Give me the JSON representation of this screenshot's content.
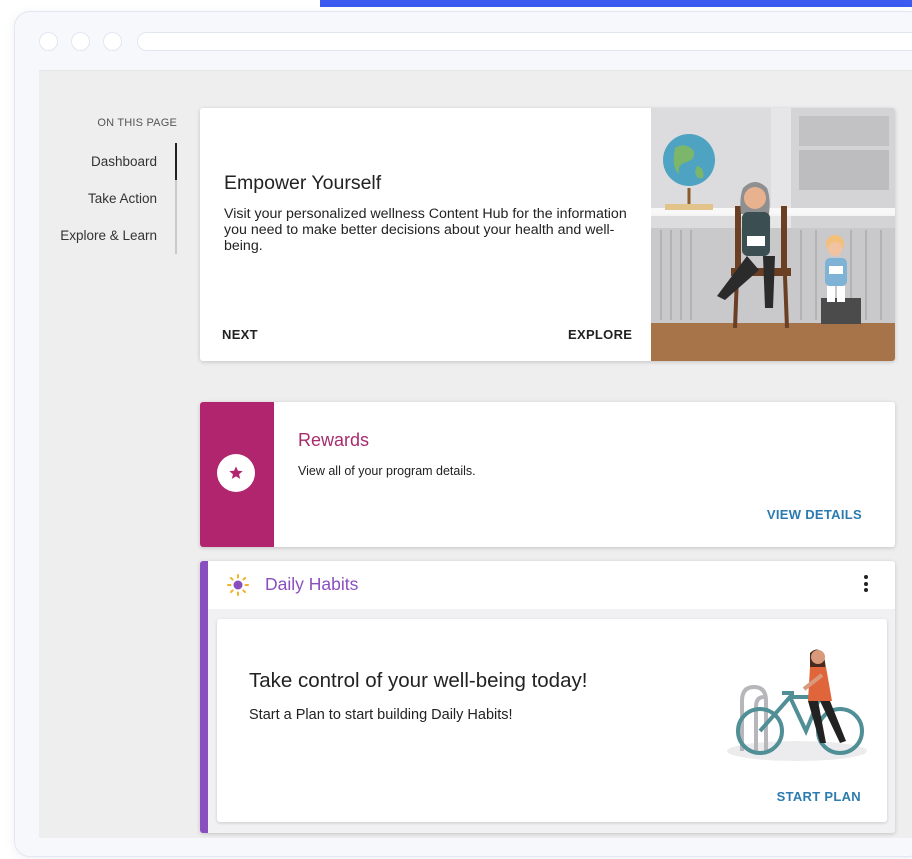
{
  "on_this_page": {
    "label": "ON THIS PAGE",
    "items": [
      {
        "label": "Dashboard",
        "active": true
      },
      {
        "label": "Take Action",
        "active": false
      },
      {
        "label": "Explore & Learn",
        "active": false
      }
    ]
  },
  "hero": {
    "title": "Empower Yourself",
    "description": "Visit your personalized wellness Content Hub for the information you need to make better decisions about your health and well-being.",
    "next_label": "NEXT",
    "explore_label": "EXPLORE"
  },
  "rewards": {
    "title": "Rewards",
    "description": "View all of your program details.",
    "link_label": "VIEW DETAILS",
    "icon": "star-icon",
    "accent_color": "#b0256e"
  },
  "daily_habits": {
    "title": "Daily Habits",
    "icon": "sun-icon",
    "headline": "Take control of your well-being today!",
    "subtext": "Start a Plan to start building Daily Habits!",
    "link_label": "START PLAN",
    "accent_color": "#8a4fbf"
  },
  "colors": {
    "link": "#2b7bb0",
    "top_accent": "#3d5af1"
  }
}
